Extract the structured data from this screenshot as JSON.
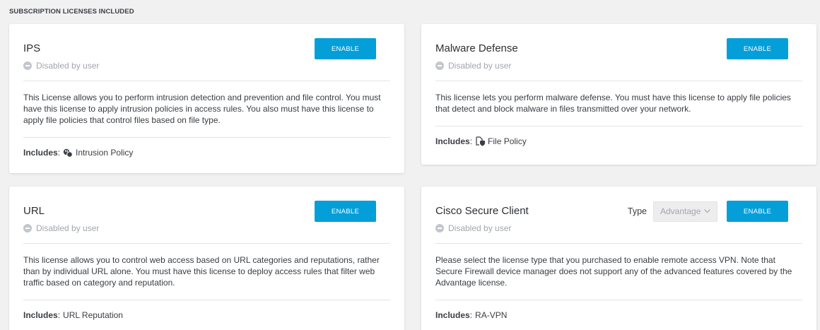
{
  "section_title": "SUBSCRIPTION LICENSES INCLUDED",
  "cards": [
    {
      "title": "IPS",
      "status": "Disabled by user",
      "enable_label": "ENABLE",
      "description": "This License allows you to perform intrusion detection and prevention and file control. You must have this license to apply intrusion policies in access rules. You also must have this license to apply file policies that control files based on file type.",
      "includes_label": "Includes",
      "includes_icon": "intrusion-policy-icon",
      "includes_value": "Intrusion Policy"
    },
    {
      "title": "Malware Defense",
      "status": "Disabled by user",
      "enable_label": "ENABLE",
      "description": "This license lets you perform malware defense. You must have this license to apply file policies that detect and block malware in files transmitted over your network.",
      "includes_label": "Includes",
      "includes_icon": "file-policy-icon",
      "includes_value": "File Policy"
    },
    {
      "title": "URL",
      "status": "Disabled by user",
      "enable_label": "ENABLE",
      "description": "This license allows you to control web access based on URL categories and reputations, rather than by individual URL alone. You must have this license to deploy access rules that filter web traffic based on category and reputation.",
      "includes_label": "Includes",
      "includes_value": "URL Reputation"
    },
    {
      "title": "Cisco Secure Client",
      "status": "Disabled by user",
      "enable_label": "ENABLE",
      "type_label": "Type",
      "type_value": "Advantage",
      "description": "Please select the license type that you purchased to enable remote access VPN. Note that Secure Firewall device manager does not support any of the advanced features covered by the Advantage license.",
      "includes_label": "Includes",
      "includes_value": "RA-VPN"
    }
  ],
  "colors": {
    "accent": "#049fd9",
    "background": "#f1f1f2",
    "status_text": "#a2a6ac"
  }
}
